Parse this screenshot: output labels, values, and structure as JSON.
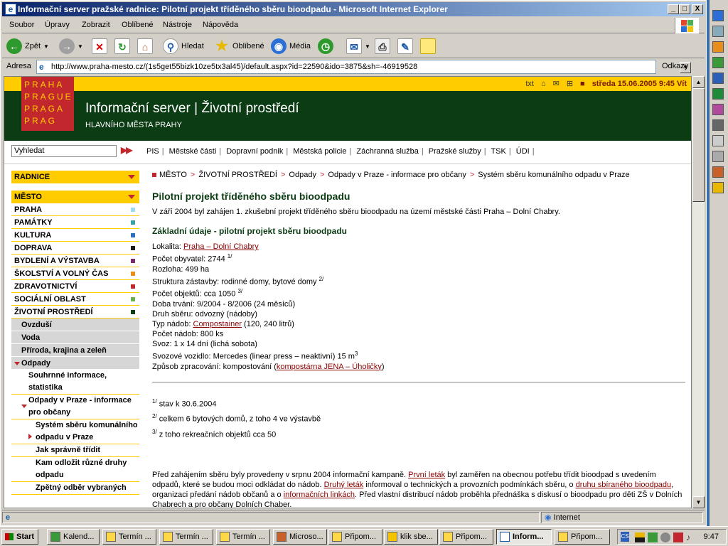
{
  "window": {
    "title": "Informační server pražské radnice: Pilotní projekt tříděného sběru bioodpadu - Microsoft Internet Explorer",
    "minimize": "_",
    "maximize": "□",
    "close": "X"
  },
  "menu": [
    "Soubor",
    "Úpravy",
    "Zobrazit",
    "Oblíbené",
    "Nástroje",
    "Nápověda"
  ],
  "toolbar": {
    "back": "Zpět",
    "search": "Hledat",
    "favorites": "Oblíbené",
    "media": "Média"
  },
  "address": {
    "label": "Adresa",
    "url": "http://www.praha-mesto.cz/(1s5get55bizk10ze5tx3al45)/default.aspx?id=22590&ido=3875&sh=-46919528",
    "links": "Odkazy"
  },
  "site": {
    "top_txt": "txt",
    "date": "středa 15.06.2005 9:45 Vít",
    "logo_lines": [
      "PRAHA",
      "PRAGUE",
      "PRAGA",
      "PRAG"
    ],
    "title": "Informační server | Životní prostředí",
    "subtitle": "HLAVNÍHO MĚSTA PRAHY",
    "search_value": "Vyhledat",
    "search_go": "▶▶",
    "topnav": [
      "PIS",
      "Městské části",
      "Dopravní podnik",
      "Městská policie",
      "Záchranná služba",
      "Pražské služby",
      "TSK",
      "ÚDI"
    ]
  },
  "sidebar": {
    "radnice": "RADNICE",
    "mesto": "MĚSTO",
    "items": [
      {
        "label": "PRAHA",
        "color": "#9fd8ef"
      },
      {
        "label": "PAMÁTKY",
        "color": "#3aa0a8"
      },
      {
        "label": "KULTURA",
        "color": "#2e6fb8"
      },
      {
        "label": "DOPRAVA",
        "color": "#1a1a1a"
      },
      {
        "label": "BYDLENÍ A VÝSTAVBA",
        "color": "#7b2c6e"
      },
      {
        "label": "ŠKOLSTVÍ A VOLNÝ ČAS",
        "color": "#e88c1c"
      },
      {
        "label": "ZDRAVOTNICTVÍ",
        "color": "#c1272d"
      },
      {
        "label": "SOCIÁLNÍ OBLAST",
        "color": "#6ab04c"
      },
      {
        "label": "ŽIVOTNÍ PROSTŘEDÍ",
        "color": "#0b3c14"
      }
    ],
    "sub": [
      "Ovzduší",
      "Voda",
      "Příroda, krajina a zeleň",
      "Odpady"
    ],
    "sub2_a": "Souhrnné informace, statistika",
    "sub2_b": "Odpady v Praze - informace pro občany",
    "sub3_active": "Systém sběru komunálního odpadu v Praze",
    "sub3": [
      "Jak správně třídit",
      "Kam odložit různé druhy odpadu",
      "Zpětný odběr vybraných"
    ]
  },
  "breadcrumb": [
    "MĚSTO",
    "ŽIVOTNÍ PROSTŘEDÍ",
    "Odpady",
    "Odpady v Praze - informace pro občany",
    "Systém sběru komunálního odpadu v Praze"
  ],
  "article": {
    "title": "Pilotní projekt tříděného sběru bioodpadu",
    "intro": "V září 2004 byl zahájen 1. zkušební projekt tříděného sběru bioodpadu na území městské části Praha – Dolní Chabry.",
    "h2": "Základní údaje - pilotní projekt sběru bioodpadu",
    "facts": {
      "lokalita_label": "Lokalita: ",
      "lokalita_link": "Praha – Dolní Chabry",
      "obyvatel": "Počet obyvatel: 2744 ",
      "obyvatel_sup": "1/",
      "rozloha": "Rozloha: 499 ha",
      "struktura": "Struktura zástavby: rodinné domy, bytové domy ",
      "struktura_sup": "2/",
      "objektu": "Počet objektů: cca 1050 ",
      "objektu_sup": "3/",
      "doba": "Doba trvání: 9/2004 - 8/2006 (24 měsíců)",
      "druh": "Druh sběru: odvozný (nádoby)",
      "typ_label": "Typ nádob: ",
      "typ_link": "Compostainer",
      "typ_rest": " (120, 240 litrů)",
      "pocet_nadob": "Počet nádob: 800 ks",
      "svoz": "Svoz: 1 x 14 dní (lichá sobota)",
      "vozidlo": "Svozové vozidlo: Mercedes (linear press – neaktivní) 15 m",
      "vozidlo_sup": "3",
      "zpracovani_label": "Způsob zpracování: kompostování (",
      "zpracovani_link": "kompostárna JENA – Úholičky",
      "zpracovani_end": ")"
    },
    "notes": [
      {
        "sup": "1/",
        "text": " stav k 30.6.2004"
      },
      {
        "sup": "2/",
        "text": " celkem 6 bytových domů, z toho 4 ve výstavbě"
      },
      {
        "sup": "3/",
        "text": " z toho rekreačních objektů cca 50"
      }
    ],
    "para": {
      "p1": "Před zahájením sběru byly provedeny v srpnu 2004 informační kampaně. ",
      "l1": "První leták",
      "p2": " byl zaměřen na obecnou potřebu třídit bioodpad s uvedením odpadů, které se budou moci odkládat do nádob. ",
      "l2": "Druhý leták",
      "p3": " informoval o technických a provozních podmínkách sběru, o ",
      "l3": "druhu sbíraného bioodpadu",
      "p4": ", organizaci předání nádob občanů a o ",
      "l4": "informačních linkách",
      "p5": ". Před vlastní distribucí nádob proběhla přednáška s diskusí o bioodpadu pro děti ZŠ v Dolních Chabrech a pro občany Dolních Chaber."
    }
  },
  "status": {
    "zone": "Internet"
  },
  "taskbar": {
    "start": "Start",
    "tasks": [
      "Kalend...",
      "Termín ...",
      "Termín ...",
      "Termín ...",
      "Microso...",
      "Připom...",
      "klik sbe...",
      "Připom...",
      "Inform...",
      "Připom..."
    ],
    "clock": "9:47"
  }
}
